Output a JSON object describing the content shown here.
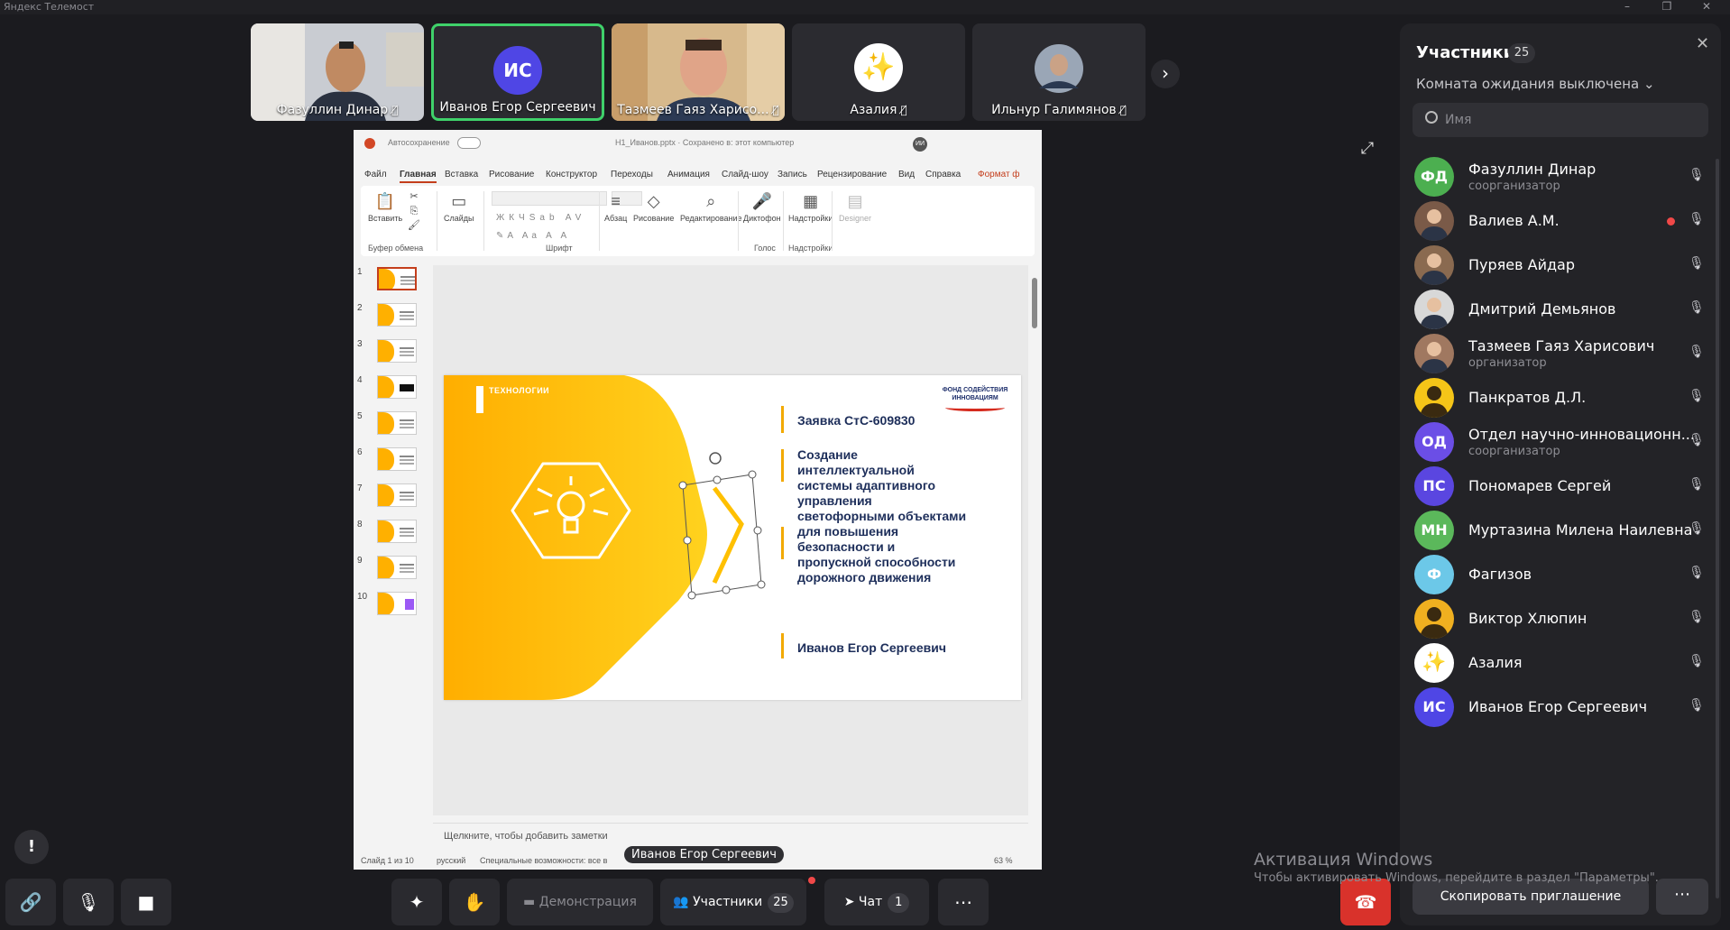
{
  "window": {
    "title": "Яндекс Телемост"
  },
  "tiles": [
    {
      "name": "Фазуллин Динар"
    },
    {
      "name": "Иванов Егор Сергеевич",
      "initials": "ИС"
    },
    {
      "name": "Тазмеев Гаяз Харисо..."
    },
    {
      "name": "Азалия",
      "avatar": "✨"
    },
    {
      "name": "Ильнур Галимянов"
    }
  ],
  "shared": {
    "autosave": "Автосохранение",
    "filename": "Н1_Иванов.pptx · Сохранено в: этот компьютер",
    "user_initials": "ИИ",
    "tabs": [
      "Файл",
      "Главная",
      "Вставка",
      "Рисование",
      "Конструктор",
      "Переходы",
      "Анимация",
      "Слайд-шоу",
      "Запись",
      "Рецензирование",
      "Вид",
      "Справка",
      "Формат ф"
    ],
    "ribbon": {
      "paste": "Вставить",
      "slides": "Слайды",
      "paragraph": "Абзац",
      "drawing": "Рисование",
      "editing": "Редактирование",
      "dictaphone": "Диктофон",
      "addins": "Надстройки",
      "designer": "Designer",
      "groups": {
        "clipboard": "Буфер обмена",
        "font": "Шрифт",
        "voice": "Голос",
        "addins": "Надстройки"
      }
    },
    "thumbnails": [
      "1",
      "2",
      "3",
      "4",
      "5",
      "6",
      "7",
      "8",
      "9",
      "10"
    ],
    "slide": {
      "logo_text": "ТЕХНОЛОГИИ",
      "fund_logo": "ФОНД СОДЕЙСТВИЯ ИННОВАЦИЯМ",
      "application": "Заявка СтС-609830",
      "description_lines": [
        "Создание",
        "интеллектуальной",
        "системы адаптивного",
        "управления",
        "светофорными объектами",
        "для повышения",
        "безопасности и",
        "пропускной способности",
        "дорожного движения"
      ],
      "author": "Иванов Егор Сергеевич"
    },
    "notes_placeholder": "Щелкните, чтобы добавить заметки",
    "status": {
      "slide": "Слайд 1 из 10",
      "lang": "русский",
      "accessibility": "Специальные возможности: все в",
      "zoom": "63 %"
    },
    "presenter": "Иванов Егор Сергеевич"
  },
  "participants": {
    "title": "Участники",
    "count": "25",
    "waiting_room": "Комната ожидания выключена",
    "search_placeholder": "Имя",
    "list": [
      {
        "initials": "ФД",
        "name": "Фазуллин Динар",
        "role": "соорганизатор",
        "color": "#4caf50"
      },
      {
        "initials": "",
        "name": "Валиев А.М.",
        "role": "",
        "color": "#7a5a48",
        "recording": true
      },
      {
        "initials": "",
        "name": "Пуряев Айдар",
        "role": "",
        "color": "#8a6a50"
      },
      {
        "initials": "",
        "name": "Дмитрий Демьянов",
        "role": "",
        "color": "#d8d8d8"
      },
      {
        "initials": "",
        "name": "Тазмеев Гаяз Харисович",
        "role": "организатор",
        "color": "#a07860"
      },
      {
        "initials": "",
        "name": "Панкратов Д.Л.",
        "role": "",
        "color": "#f5c518"
      },
      {
        "initials": "ОД",
        "name": "Отдел научно-инновационн...",
        "role": "соорганизатор",
        "color": "#6b4ee6"
      },
      {
        "initials": "ПС",
        "name": "Пономарев Сергей",
        "role": "",
        "color": "#5a46e0"
      },
      {
        "initials": "МН",
        "name": "Муртазина Милена Наилевна",
        "role": "",
        "color": "#5bb85b"
      },
      {
        "initials": "Ф",
        "name": "Фагизов",
        "role": "",
        "color": "#6cc8e8"
      },
      {
        "initials": "",
        "name": "Виктор Хлюпин",
        "role": "",
        "color": "#f0b020"
      },
      {
        "initials": "✨",
        "name": "Азалия",
        "role": "",
        "color": "#ffffff"
      },
      {
        "initials": "ИС",
        "name": "Иванов Егор Сергеевич",
        "role": "",
        "color": "#4f46e5"
      }
    ]
  },
  "toolbar": {
    "demo_label": "Демонстрация",
    "participants_label": "Участники",
    "participants_count": "25",
    "chat_label": "Чат",
    "chat_count": "1",
    "copy_invite": "Скопировать приглашение"
  },
  "windows_activation": {
    "title": "Активация Windows",
    "subtitle": "Чтобы активировать Windows, перейдите в раздел \"Параметры\"."
  }
}
